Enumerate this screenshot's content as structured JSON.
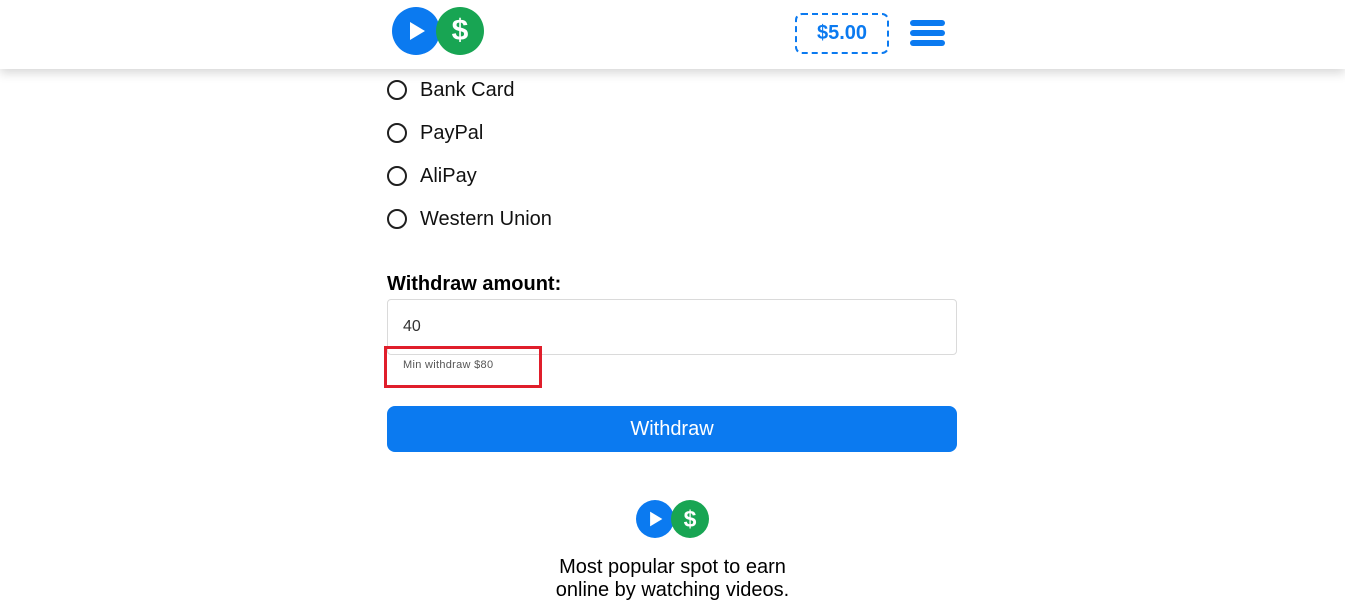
{
  "header": {
    "logo_icons": [
      "play-icon",
      "dollar-icon"
    ],
    "dollar_symbol": "$",
    "balance": "$5.00",
    "menu_icon": "hamburger-menu-icon"
  },
  "payment_methods": [
    {
      "label": "Bank Card",
      "selected": false
    },
    {
      "label": "PayPal",
      "selected": false
    },
    {
      "label": "AliPay",
      "selected": false
    },
    {
      "label": "Western Union",
      "selected": false
    }
  ],
  "withdraw": {
    "amount_label": "Withdraw amount:",
    "amount_value": "40",
    "min_note": "Min withdraw $80",
    "button_label": "Withdraw"
  },
  "footer": {
    "dollar_symbol": "$",
    "tagline_line1": "Most popular spot to earn",
    "tagline_line2": "online by watching videos."
  },
  "colors": {
    "primary_blue": "#0b7af0",
    "green": "#18a553",
    "highlight_red": "#e01e2b"
  }
}
